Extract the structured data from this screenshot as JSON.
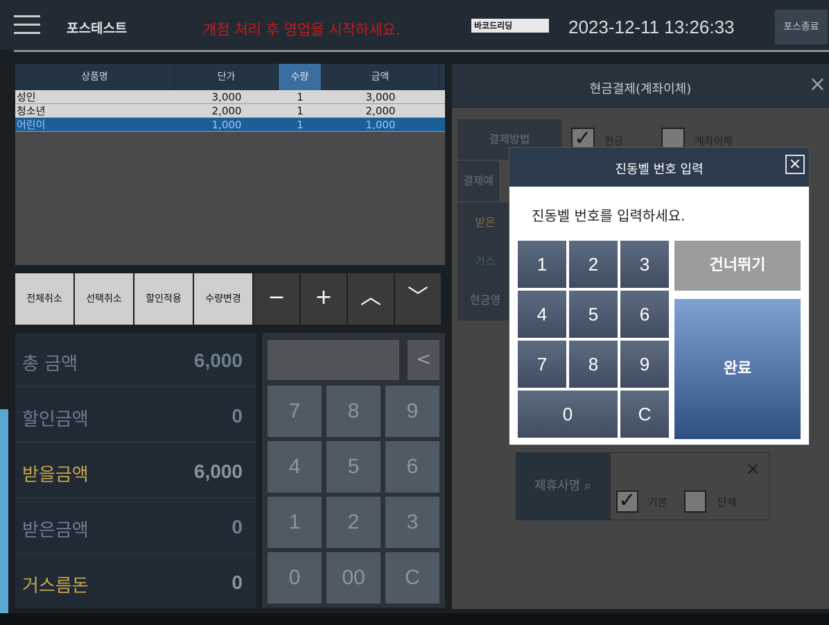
{
  "header": {
    "app_title": "포스테스트",
    "alert": "개점 처리 후 영업을 시작하세요.",
    "barcode_label": "바코드리딩",
    "datetime": "2023-12-11 13:26:33",
    "exit_label": "포스종료"
  },
  "table": {
    "headers": [
      "상품명",
      "단가",
      "수량",
      "금액"
    ],
    "rows": [
      {
        "name": "성인",
        "price": "3,000",
        "qty": "1",
        "amount": "3,000"
      },
      {
        "name": "청소년",
        "price": "2,000",
        "qty": "1",
        "amount": "2,000"
      },
      {
        "name": "어린이",
        "price": "1,000",
        "qty": "1",
        "amount": "1,000"
      }
    ]
  },
  "actions": {
    "cancel_all": "전체취소",
    "cancel_selected": "선택취소",
    "apply_discount": "할인적용",
    "change_qty": "수량변경",
    "minus": "−",
    "plus": "+",
    "up": "︿",
    "down": "﹀"
  },
  "summary": {
    "total_label": "총 금액",
    "total_value": "6,000",
    "discount_label": "할인금액",
    "discount_value": "0",
    "receivable_label": "받을금액",
    "receivable_value": "6,000",
    "received_label": "받은금액",
    "received_value": "0",
    "change_label": "거스름돈",
    "change_value": "0"
  },
  "numpad": {
    "back": "<",
    "keys": [
      "7",
      "8",
      "9",
      "4",
      "5",
      "6",
      "1",
      "2",
      "3",
      "0",
      "00",
      "C"
    ]
  },
  "payment_panel": {
    "title": "현금결제(계좌이체)",
    "close": "×",
    "rows": [
      "결제방법",
      "결제예",
      "받은",
      "거스",
      "현금영"
    ],
    "option_cash": "현금",
    "option_transfer": "계좌이체",
    "partner_label": "제휴사명 ⌕",
    "partner_clear": "×",
    "partner_basic": "기본",
    "partner_group": "단체",
    "check_mark": "✓"
  },
  "modal": {
    "title": "진동벨 번호 입력",
    "close": "×",
    "prompt": "진동벨 번호를 입력하세요.",
    "keys": [
      "1",
      "2",
      "3",
      "4",
      "5",
      "6",
      "7",
      "8",
      "9",
      "0",
      "C"
    ],
    "skip": "건너뛰기",
    "done": "완료"
  },
  "colors": {
    "alert": "#c8191b",
    "selected_row": "#1b5f98",
    "receivable_text": "#c9a64a",
    "change_text": "#c9a64a",
    "done_button": "#2e4f80"
  }
}
